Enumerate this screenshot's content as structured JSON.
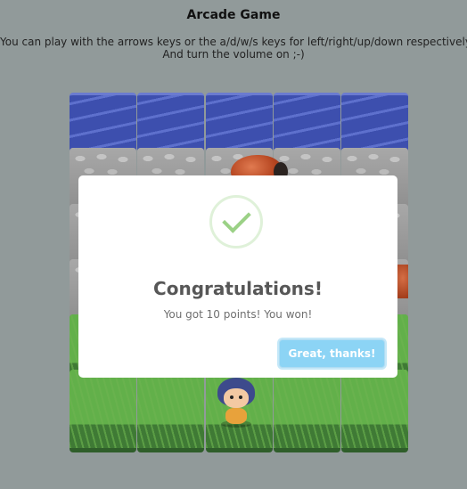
{
  "page": {
    "title": "Arcade Game",
    "instructions_line1": "You can play with the arrows keys or the a/d/w/s keys for left/right/up/down respectively.",
    "instructions_line2": "And turn the volume on ;-)"
  },
  "board": {
    "rows": [
      "water",
      "stone",
      "stone",
      "stone",
      "grass",
      "grass"
    ],
    "columns": 5,
    "enemies": [
      "enemy-bug",
      "enemy-bug"
    ],
    "player": "player-character"
  },
  "modal": {
    "icon": "success-check-icon",
    "heading": "Congratulations!",
    "message": "You got 10 points! You won!",
    "confirm_label": "Great, thanks!"
  },
  "colors": {
    "background": "#919a9a",
    "confirm_button": "#8cd4f5",
    "success_check": "#9bd186"
  }
}
